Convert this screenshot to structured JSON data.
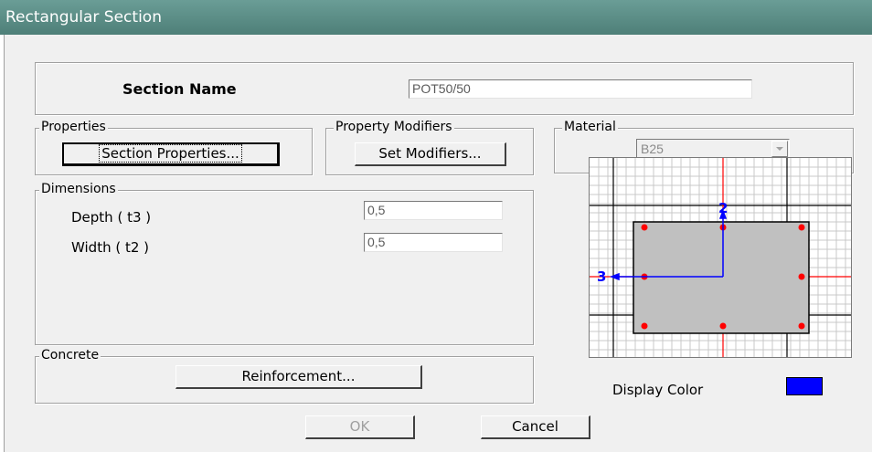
{
  "window": {
    "title": "Rectangular Section"
  },
  "section_name": {
    "label": "Section Name",
    "value": "POT50/50"
  },
  "properties": {
    "legend": "Properties",
    "button": "Section Properties..."
  },
  "modifiers": {
    "legend": "Property Modifiers",
    "button": "Set Modifiers..."
  },
  "material": {
    "legend": "Material",
    "value": "B25"
  },
  "dimensions": {
    "legend": "Dimensions",
    "depth_label": "Depth ( t3 )",
    "depth_value": "0,5",
    "width_label": "Width ( t2 )",
    "width_value": "0,5"
  },
  "concrete": {
    "legend": "Concrete",
    "button": "Reinforcement..."
  },
  "preview": {
    "axis2": "2",
    "axis3": "3"
  },
  "display_color": {
    "label": "Display Color",
    "color": "#0000ff"
  },
  "buttons": {
    "ok": "OK",
    "cancel": "Cancel"
  }
}
